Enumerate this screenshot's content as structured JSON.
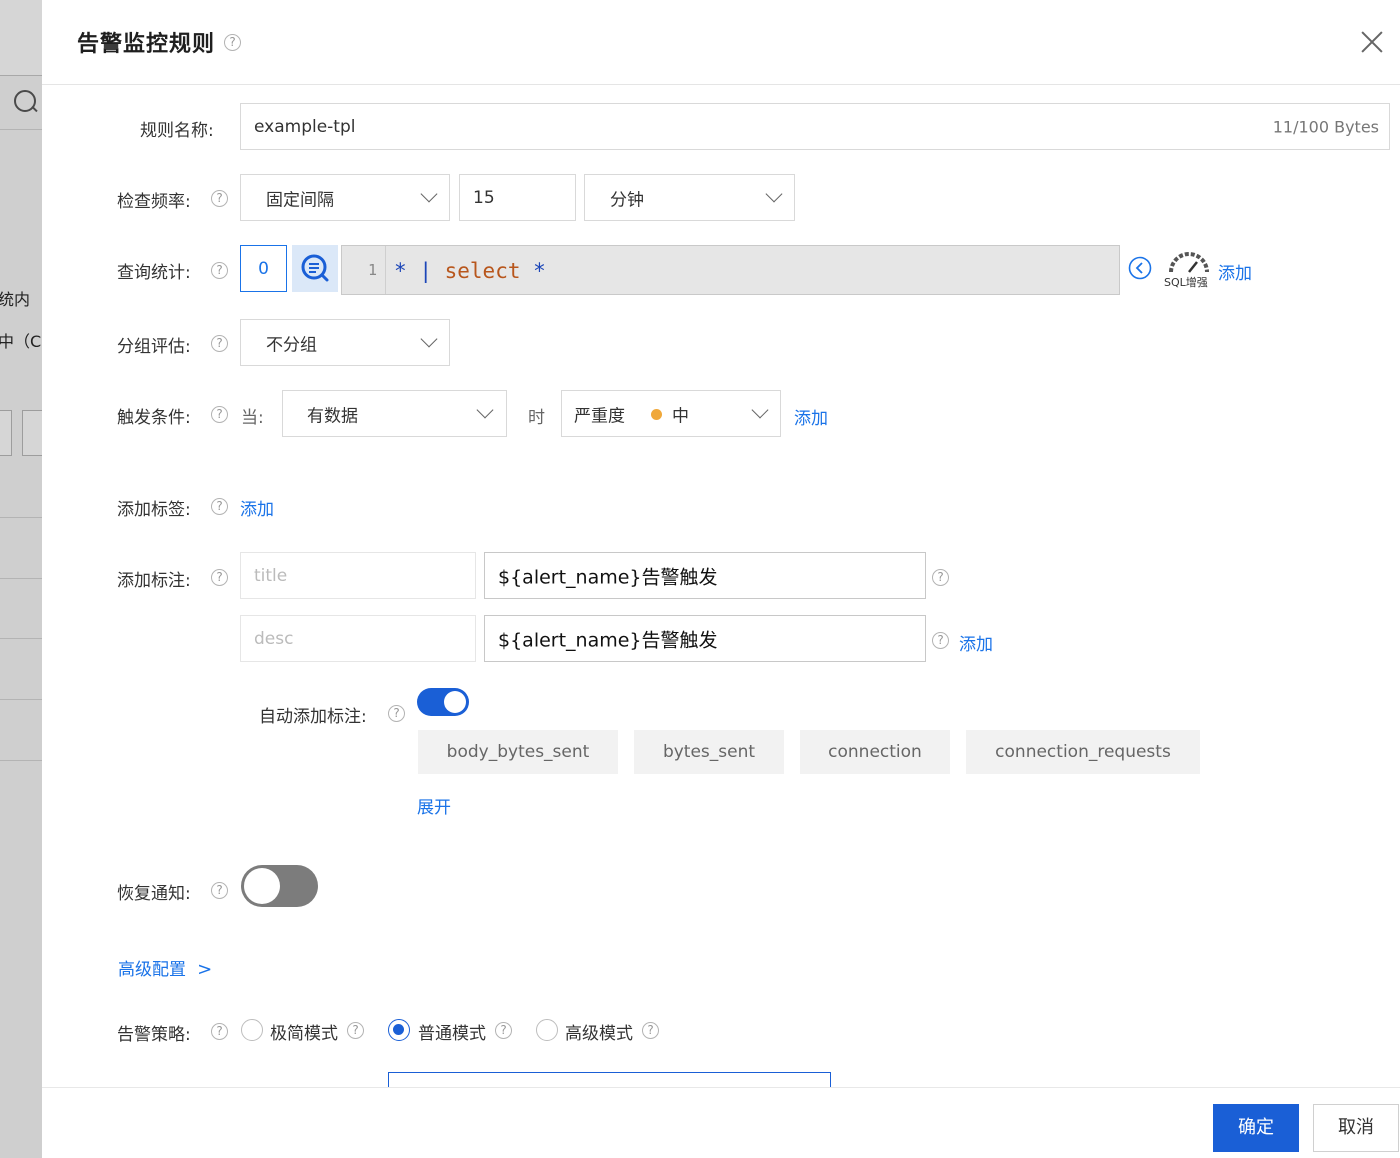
{
  "background": {
    "partial_text_1": "统内",
    "partial_text_2": "中（C"
  },
  "dialog": {
    "title": "告警监控规则",
    "help_glyph": "?"
  },
  "rule_name": {
    "label": "规则名称:",
    "value": "example-tpl",
    "counter": "11/100 Bytes"
  },
  "check_frequency": {
    "label": "检查频率:",
    "mode": "固定间隔",
    "interval": "15",
    "unit": "分钟"
  },
  "query": {
    "label": "查询统计:",
    "count": "0",
    "line_number": "1",
    "code_star": "*",
    "code_pipe": "|",
    "code_select": "select",
    "code_star2": "*",
    "sql_badge": "SQL增强",
    "add_label": "添加"
  },
  "group_eval": {
    "label": "分组评估:",
    "value": "不分组"
  },
  "trigger": {
    "label": "触发条件:",
    "when": "当:",
    "condition": "有数据",
    "then": "时",
    "severity_label": "严重度",
    "severity_value": "中",
    "severity_color": "#f0a83a",
    "add_label": "添加"
  },
  "labels": {
    "label": "添加标签:",
    "add_label": "添加"
  },
  "annotations": {
    "label": "添加标注:",
    "rows": [
      {
        "key_placeholder": "title",
        "value": "${alert_name}告警触发"
      },
      {
        "key_placeholder": "desc",
        "value": "${alert_name}告警触发"
      }
    ],
    "add_label": "添加"
  },
  "auto_annotation": {
    "label": "自动添加标注:",
    "enabled": true,
    "tags": [
      "body_bytes_sent",
      "bytes_sent",
      "connection",
      "connection_requests"
    ],
    "expand_label": "展开"
  },
  "recovery": {
    "label": "恢复通知:",
    "enabled": false
  },
  "advanced": {
    "label": "高级配置",
    "chevron": ">"
  },
  "policy": {
    "label": "告警策略:",
    "options": [
      "极简模式",
      "普通模式",
      "高级模式"
    ],
    "selected": "普通模式"
  },
  "footer": {
    "confirm": "确定",
    "cancel": "取消"
  },
  "colors": {
    "primary": "#1a5fd6",
    "link": "#1a73e8"
  }
}
